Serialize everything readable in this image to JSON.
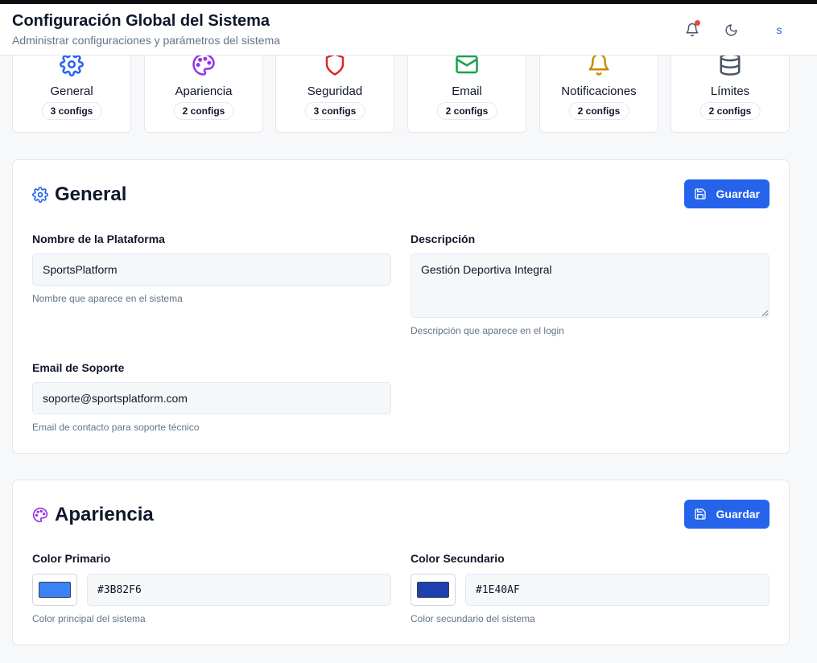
{
  "header": {
    "title": "Configuración Global del Sistema",
    "subtitle": "Administrar configuraciones y parámetros del sistema",
    "avatar_initial": "S",
    "notification_dot_color": "#ef4444"
  },
  "categories": [
    {
      "icon": "gear-icon",
      "label": "General",
      "badge": "3 configs",
      "color": "#2563eb"
    },
    {
      "icon": "palette-icon",
      "label": "Apariencia",
      "badge": "2 configs",
      "color": "#9333ea"
    },
    {
      "icon": "shield-icon",
      "label": "Seguridad",
      "badge": "3 configs",
      "color": "#dc2626"
    },
    {
      "icon": "mail-icon",
      "label": "Email",
      "badge": "2 configs",
      "color": "#16a34a"
    },
    {
      "icon": "bell-icon",
      "label": "Notificaciones",
      "badge": "2 configs",
      "color": "#ca8a04"
    },
    {
      "icon": "database-icon",
      "label": "Límites",
      "badge": "2 configs",
      "color": "#475569"
    }
  ],
  "general": {
    "title": "General",
    "save_label": "Guardar",
    "platform_name": {
      "label": "Nombre de la Plataforma",
      "value": "SportsPlatform",
      "help": "Nombre que aparece en el sistema"
    },
    "description": {
      "label": "Descripción",
      "value": "Gestión Deportiva Integral",
      "help": "Descripción que aparece en el login"
    },
    "support_email": {
      "label": "Email de Soporte",
      "value": "soporte@sportsplatform.com",
      "help": "Email de contacto para soporte técnico"
    }
  },
  "appearance": {
    "title": "Apariencia",
    "save_label": "Guardar",
    "primary_color": {
      "label": "Color Primario",
      "value": "#3B82F6",
      "help": "Color principal del sistema"
    },
    "secondary_color": {
      "label": "Color Secundario",
      "value": "#1E40AF",
      "help": "Color secundario del sistema"
    }
  },
  "colors": {
    "accent": "#2563eb",
    "primary_swatch": "#3B82F6",
    "secondary_swatch": "#1E40AF"
  }
}
